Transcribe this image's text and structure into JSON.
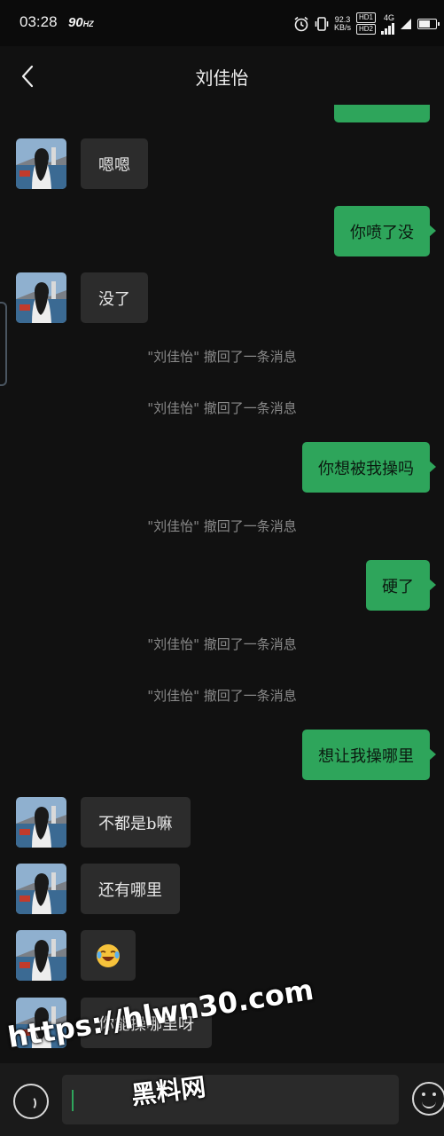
{
  "status_bar": {
    "time": "03:28",
    "refresh_rate": "90",
    "refresh_unit": "HZ",
    "net_speed_value": "92.3",
    "net_speed_unit": "KB/s",
    "hd_labels": [
      "HD1",
      "HD2"
    ],
    "network": "4G",
    "icons": [
      "alarm-icon",
      "vibrate-icon",
      "signal-icon",
      "wifi-icon",
      "battery-icon"
    ]
  },
  "header": {
    "title": "刘佳怡",
    "back_icon": "chevron-left-icon"
  },
  "messages": [
    {
      "side": "in",
      "text": "嗯嗯"
    },
    {
      "side": "out",
      "text": "你喷了没"
    },
    {
      "side": "in",
      "text": "没了"
    },
    {
      "side": "system",
      "text": "\"刘佳怡\" 撤回了一条消息"
    },
    {
      "side": "system",
      "text": "\"刘佳怡\" 撤回了一条消息"
    },
    {
      "side": "out",
      "text": "你想被我操吗"
    },
    {
      "side": "system",
      "text": "\"刘佳怡\" 撤回了一条消息"
    },
    {
      "side": "out",
      "text": "硬了"
    },
    {
      "side": "system",
      "text": "\"刘佳怡\" 撤回了一条消息"
    },
    {
      "side": "system",
      "text": "\"刘佳怡\" 撤回了一条消息"
    },
    {
      "side": "out",
      "text": "想让我操哪里"
    },
    {
      "side": "in",
      "text": "不都是b嘛"
    },
    {
      "side": "in",
      "text": "还有哪里"
    },
    {
      "side": "in",
      "text": "😂",
      "emoji_name": "laughing-crying-emoji"
    },
    {
      "side": "in",
      "text": "你能操哪里呀"
    }
  ],
  "input_bar": {
    "value": "",
    "voice_icon": "voice-icon",
    "emoji_icon": "smile-icon"
  },
  "watermark": {
    "url": "https://hlwn30.com",
    "label": "黑料网"
  },
  "colors": {
    "background": "#111111",
    "outgoing_bubble": "#2ea55b",
    "incoming_bubble": "#2c2c2c",
    "system_text": "#8a8a8a"
  }
}
